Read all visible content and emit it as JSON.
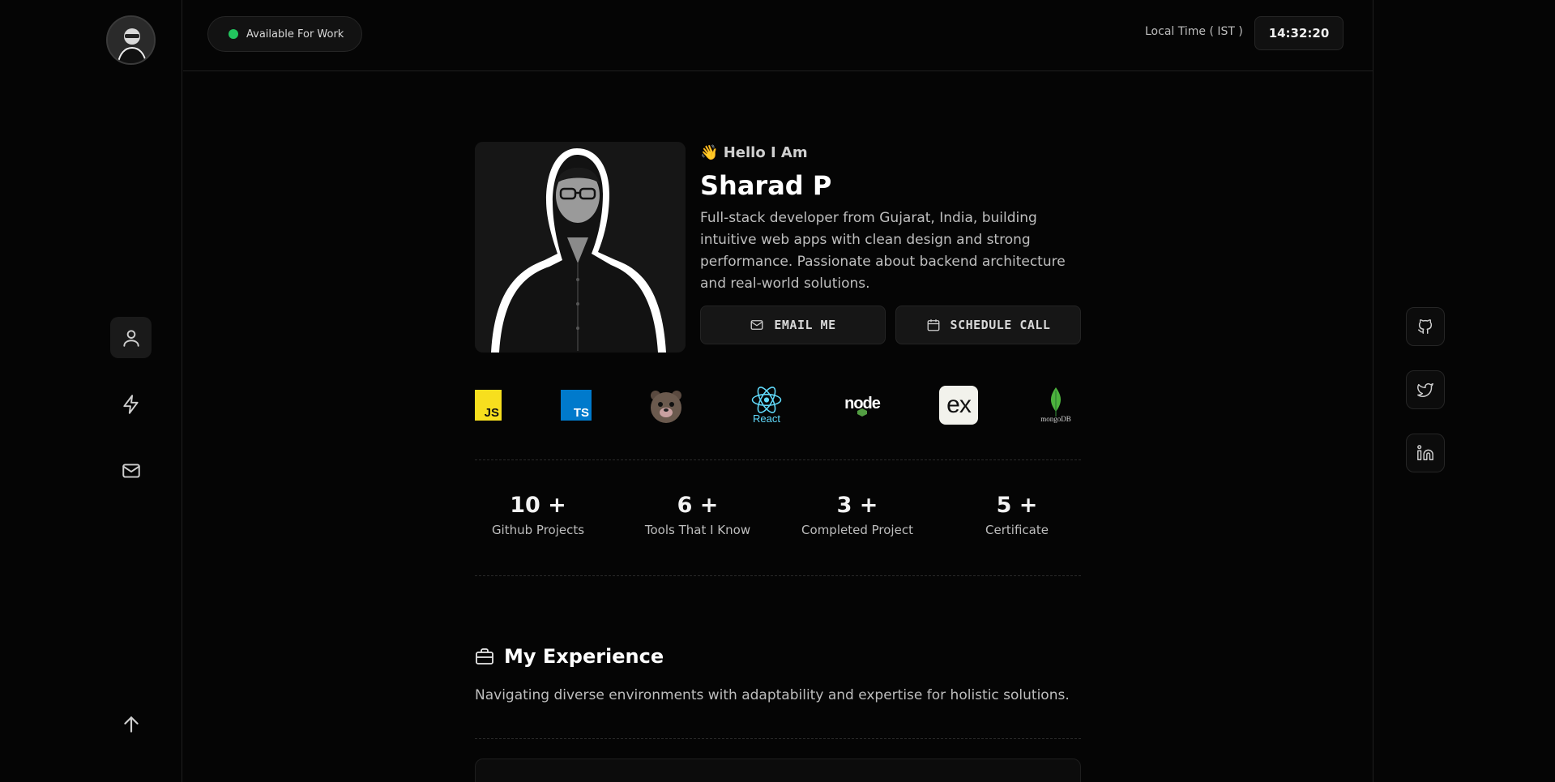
{
  "header": {
    "status_label": "Available For Work",
    "time_label": "Local Time ( IST )",
    "time_value": "14:32:20"
  },
  "profile": {
    "greeting_emoji": "👋",
    "greeting": "Hello I Am",
    "name": "Sharad P",
    "bio": "Full-stack developer from Gujarat, India, building intuitive web apps with clean design and strong performance. Passionate about backend architecture and real-world solutions.",
    "email_button": "EMAIL ME",
    "schedule_button": "SCHEDULE CALL"
  },
  "tech_logos": [
    {
      "icon": "javascript-icon",
      "text": "JS"
    },
    {
      "icon": "typescript-icon",
      "text": "TS"
    },
    {
      "icon": "bear-mascot-icon",
      "text": ""
    },
    {
      "icon": "react-icon",
      "text": "React"
    },
    {
      "icon": "nodejs-icon",
      "text": "node"
    },
    {
      "icon": "express-icon",
      "text": "ex"
    },
    {
      "icon": "mongodb-icon",
      "text": "mongoDB"
    }
  ],
  "stats": [
    {
      "value": "10 +",
      "label": "Github Projects"
    },
    {
      "value": "6 +",
      "label": "Tools That I Know"
    },
    {
      "value": "3 +",
      "label": "Completed Project"
    },
    {
      "value": "5 +",
      "label": "Certificate"
    }
  ],
  "experience": {
    "title": "My Experience",
    "subtitle": "Navigating diverse environments with adaptability and expertise for holistic solutions."
  },
  "sidebar": {
    "items": [
      {
        "icon": "user-icon"
      },
      {
        "icon": "lightning-icon"
      },
      {
        "icon": "mail-icon"
      }
    ],
    "scroll_top_icon": "arrow-up-icon"
  },
  "socials": [
    {
      "icon": "github-icon"
    },
    {
      "icon": "twitter-icon"
    },
    {
      "icon": "linkedin-icon"
    }
  ],
  "colors": {
    "background": "#050505",
    "status_dot": "#22c55e",
    "react": "#61dafb",
    "typescript": "#007acc",
    "javascript": "#f7df1e",
    "mongodb": "#4db33d"
  }
}
